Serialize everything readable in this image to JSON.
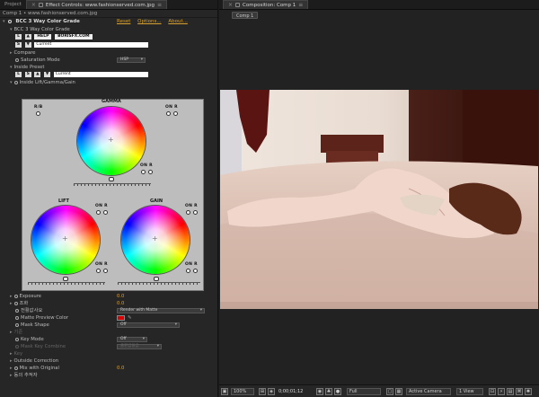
{
  "left": {
    "tabs": [
      {
        "label": "Project"
      },
      {
        "label": "Effect Controls: www.fashionserved.com.jpg"
      }
    ],
    "subheader": "Comp 1 • www.fashionserved.com.jpg",
    "effect": {
      "name": "BCC 3 Way Color Grade",
      "links": {
        "reset": "Reset",
        "options": "Options...",
        "about": "About..."
      },
      "group_label": "BCC 3 Way Color Grade",
      "preset_buttons": {
        "l": "L",
        "s": "S",
        "help": "HELP",
        "site": "BORISFX.COM"
      },
      "preset_field": "Current",
      "compare_label": "Compare",
      "saturation_mode_label": "Saturation Mode",
      "saturation_mode_value": "HSP",
      "inside_preset_label": "Inside Preset",
      "inside_preset_field": "Current",
      "inside_lgg_label": "Inside Lift/Gamma/Gain",
      "grade": {
        "gamma": "GAMMA",
        "lift": "LIFT",
        "gain": "GAIN",
        "rb": "R/B",
        "on": "ON",
        "r": "R"
      },
      "params": [
        {
          "label": "Exposure",
          "value": "0.0"
        },
        {
          "label": "조화",
          "value": "0.0"
        },
        {
          "label": "전활값사요",
          "value": "Render with Matte"
        },
        {
          "label": "Matte Preview Color",
          "value": ""
        },
        {
          "label": "Mask Shape",
          "value": "Off"
        },
        {
          "label": "기준",
          "value": ""
        },
        {
          "label": "Key Mode",
          "value": "Off"
        },
        {
          "label": "Mask Key Combine",
          "value": "출판값을값"
        },
        {
          "label": "Key",
          "value": ""
        },
        {
          "label": "Outside Correction",
          "value": ""
        },
        {
          "label": "Mix with Original",
          "value": "0.0"
        },
        {
          "label": "동의 추적자",
          "value": ""
        }
      ]
    }
  },
  "right": {
    "tab": "Composition: Comp 1",
    "comp_chip": "Comp 1",
    "bottom": {
      "zoom": "100%",
      "timecode": "0;00;01;12",
      "resolution": "Full",
      "camera": "Active Camera",
      "views": "1 View"
    }
  },
  "colors": {
    "accent": "#d8a233",
    "matte_preview": "#dd0000",
    "panel": "#262626"
  }
}
